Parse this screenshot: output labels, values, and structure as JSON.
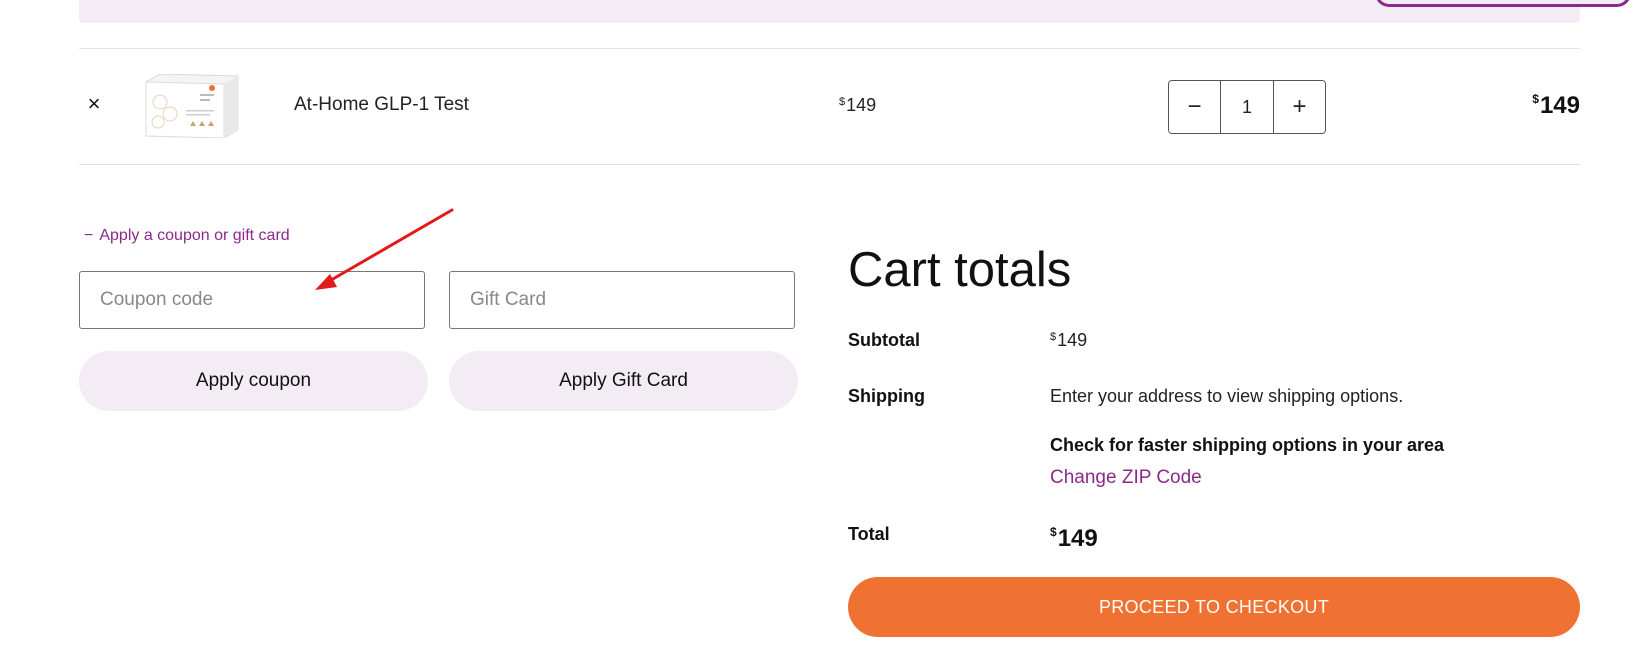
{
  "cart_row": {
    "remove_label": "×",
    "product_name": "At-Home GLP-1 Test",
    "unit_price": {
      "currency": "$",
      "amount": "149"
    },
    "quantity": "1",
    "qty_minus": "−",
    "qty_plus": "+",
    "line_total": {
      "currency": "$",
      "amount": "149"
    }
  },
  "coupon": {
    "toggle_icon": "−",
    "toggle_label": "Apply a coupon or gift card",
    "coupon_placeholder": "Coupon code",
    "gift_placeholder": "Gift Card",
    "apply_coupon_label": "Apply coupon",
    "apply_gift_label": "Apply Gift Card"
  },
  "totals": {
    "title": "Cart totals",
    "subtotal_label": "Subtotal",
    "subtotal": {
      "currency": "$",
      "amount": "149"
    },
    "shipping_label": "Shipping",
    "shipping_text": "Enter your address to view shipping options.",
    "faster_shipping_note": "Check for faster shipping options in your area",
    "change_zip_label": "Change ZIP Code",
    "total_label": "Total",
    "total": {
      "currency": "$",
      "amount": "149"
    },
    "checkout_label": "PROCEED TO CHECKOUT"
  },
  "colors": {
    "accent_purple": "#8b2a8b",
    "checkout_orange": "#f07232",
    "pill_background": "#f3ecf4",
    "annotation_red": "#e01b1b"
  },
  "icons": {
    "remove": "close-icon",
    "annotation": "red-arrow-icon"
  }
}
